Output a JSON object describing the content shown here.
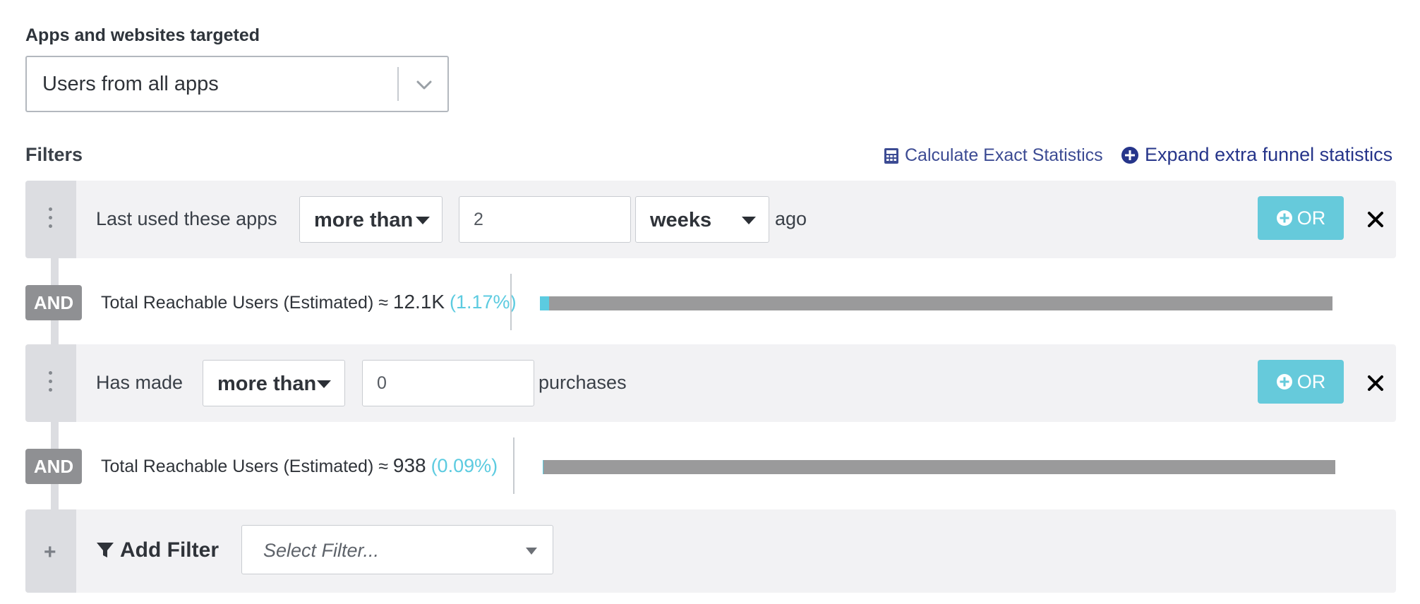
{
  "apps_section": {
    "label": "Apps and websites targeted",
    "selected": "Users from all apps"
  },
  "filters": {
    "title": "Filters",
    "calc_link": "Calculate Exact Statistics",
    "expand_link": "Expand extra funnel statistics"
  },
  "filter1": {
    "label": "Last used these apps",
    "comparator": "more than",
    "value": "2",
    "unit": "weeks",
    "suffix": "ago",
    "or_label": "OR"
  },
  "and1": {
    "badge": "AND",
    "text": "Total Reachable Users (Estimated) ≈",
    "count": "12.1K",
    "pct": "(1.17%)",
    "fill_fraction": 0.0117
  },
  "filter2": {
    "label": "Has made",
    "comparator": "more than",
    "value": "0",
    "suffix": "purchases",
    "or_label": "OR"
  },
  "and2": {
    "badge": "AND",
    "text": "Total Reachable Users (Estimated) ≈",
    "count": "938",
    "pct": "(0.09%)",
    "fill_fraction": 0.0009
  },
  "add_filter": {
    "plus": "+",
    "label": "Add Filter",
    "placeholder": "Select Filter..."
  },
  "colors": {
    "accent": "#66cadb",
    "link": "#26358a",
    "badge": "#8f9093",
    "bar": "#9a9a9b"
  },
  "icons": [
    "chevron-down-icon",
    "calculator-icon",
    "plus-circle-icon",
    "drag-handle-icon",
    "caret-down-icon",
    "close-icon",
    "filter-icon",
    "plus-icon"
  ]
}
